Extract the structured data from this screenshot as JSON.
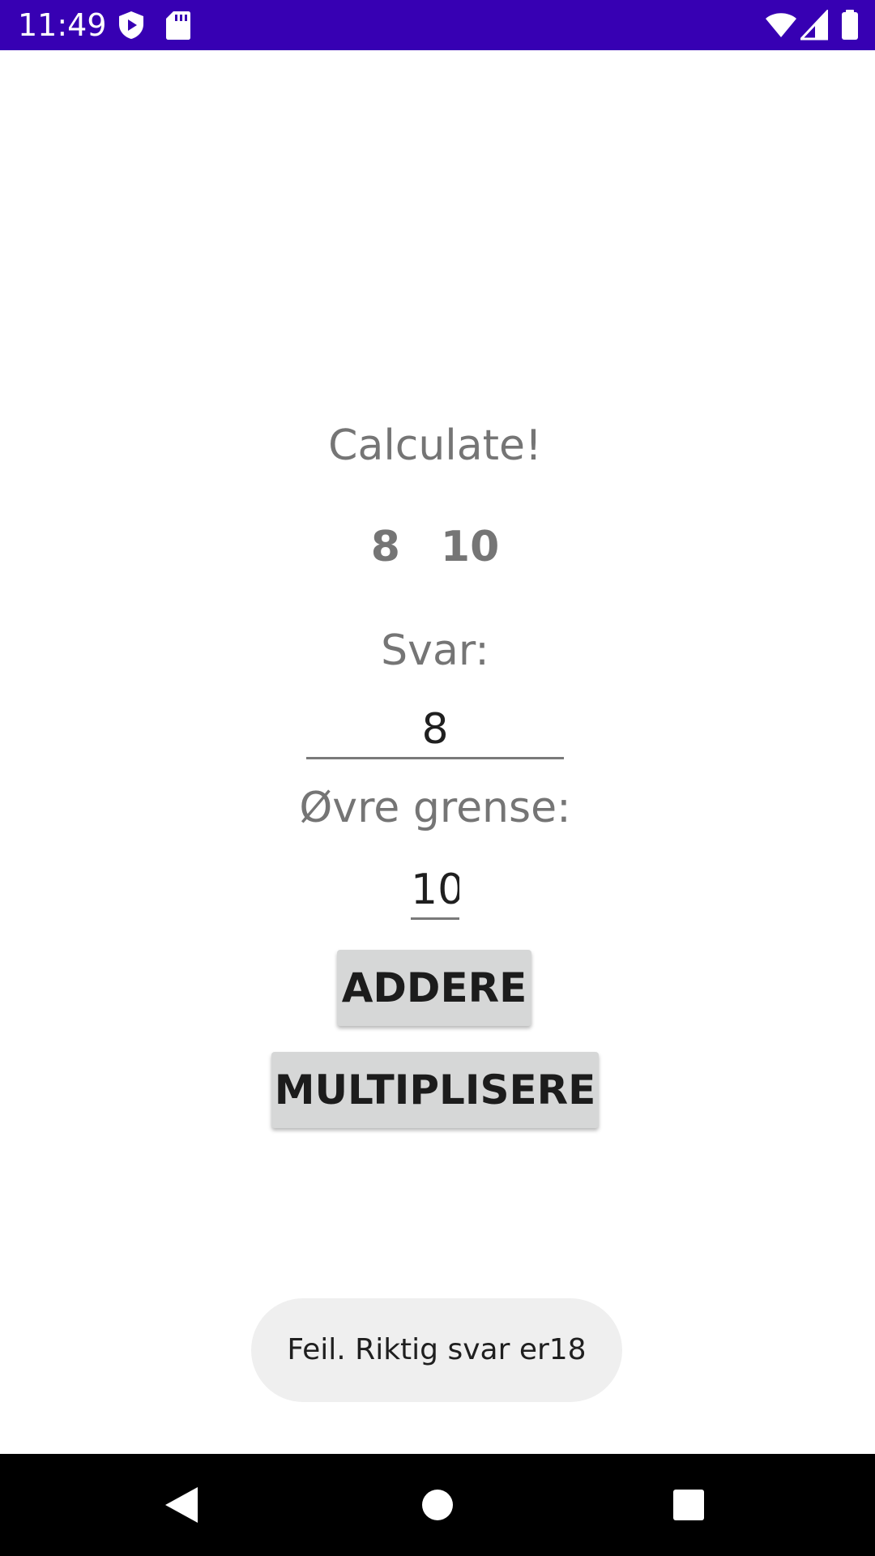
{
  "status_bar": {
    "time": "11:49",
    "background": "#3700b3",
    "icons": [
      "play-protect-icon",
      "sd-card-icon",
      "wifi-icon",
      "cell-signal-icon",
      "battery-icon"
    ]
  },
  "main": {
    "title": "Calculate!",
    "number_a": "8",
    "number_b": "10",
    "answer_label": "Svar:",
    "answer_value": "8",
    "upper_limit_label": "Øvre grense:",
    "upper_limit_value": "10",
    "add_button": "ADDERE",
    "multiply_button": "MULTIPLISERE"
  },
  "toast": {
    "message": "Feil. Riktig svar er18"
  },
  "nav_bar": {
    "icons": [
      "back-icon",
      "home-icon",
      "recents-icon"
    ]
  }
}
